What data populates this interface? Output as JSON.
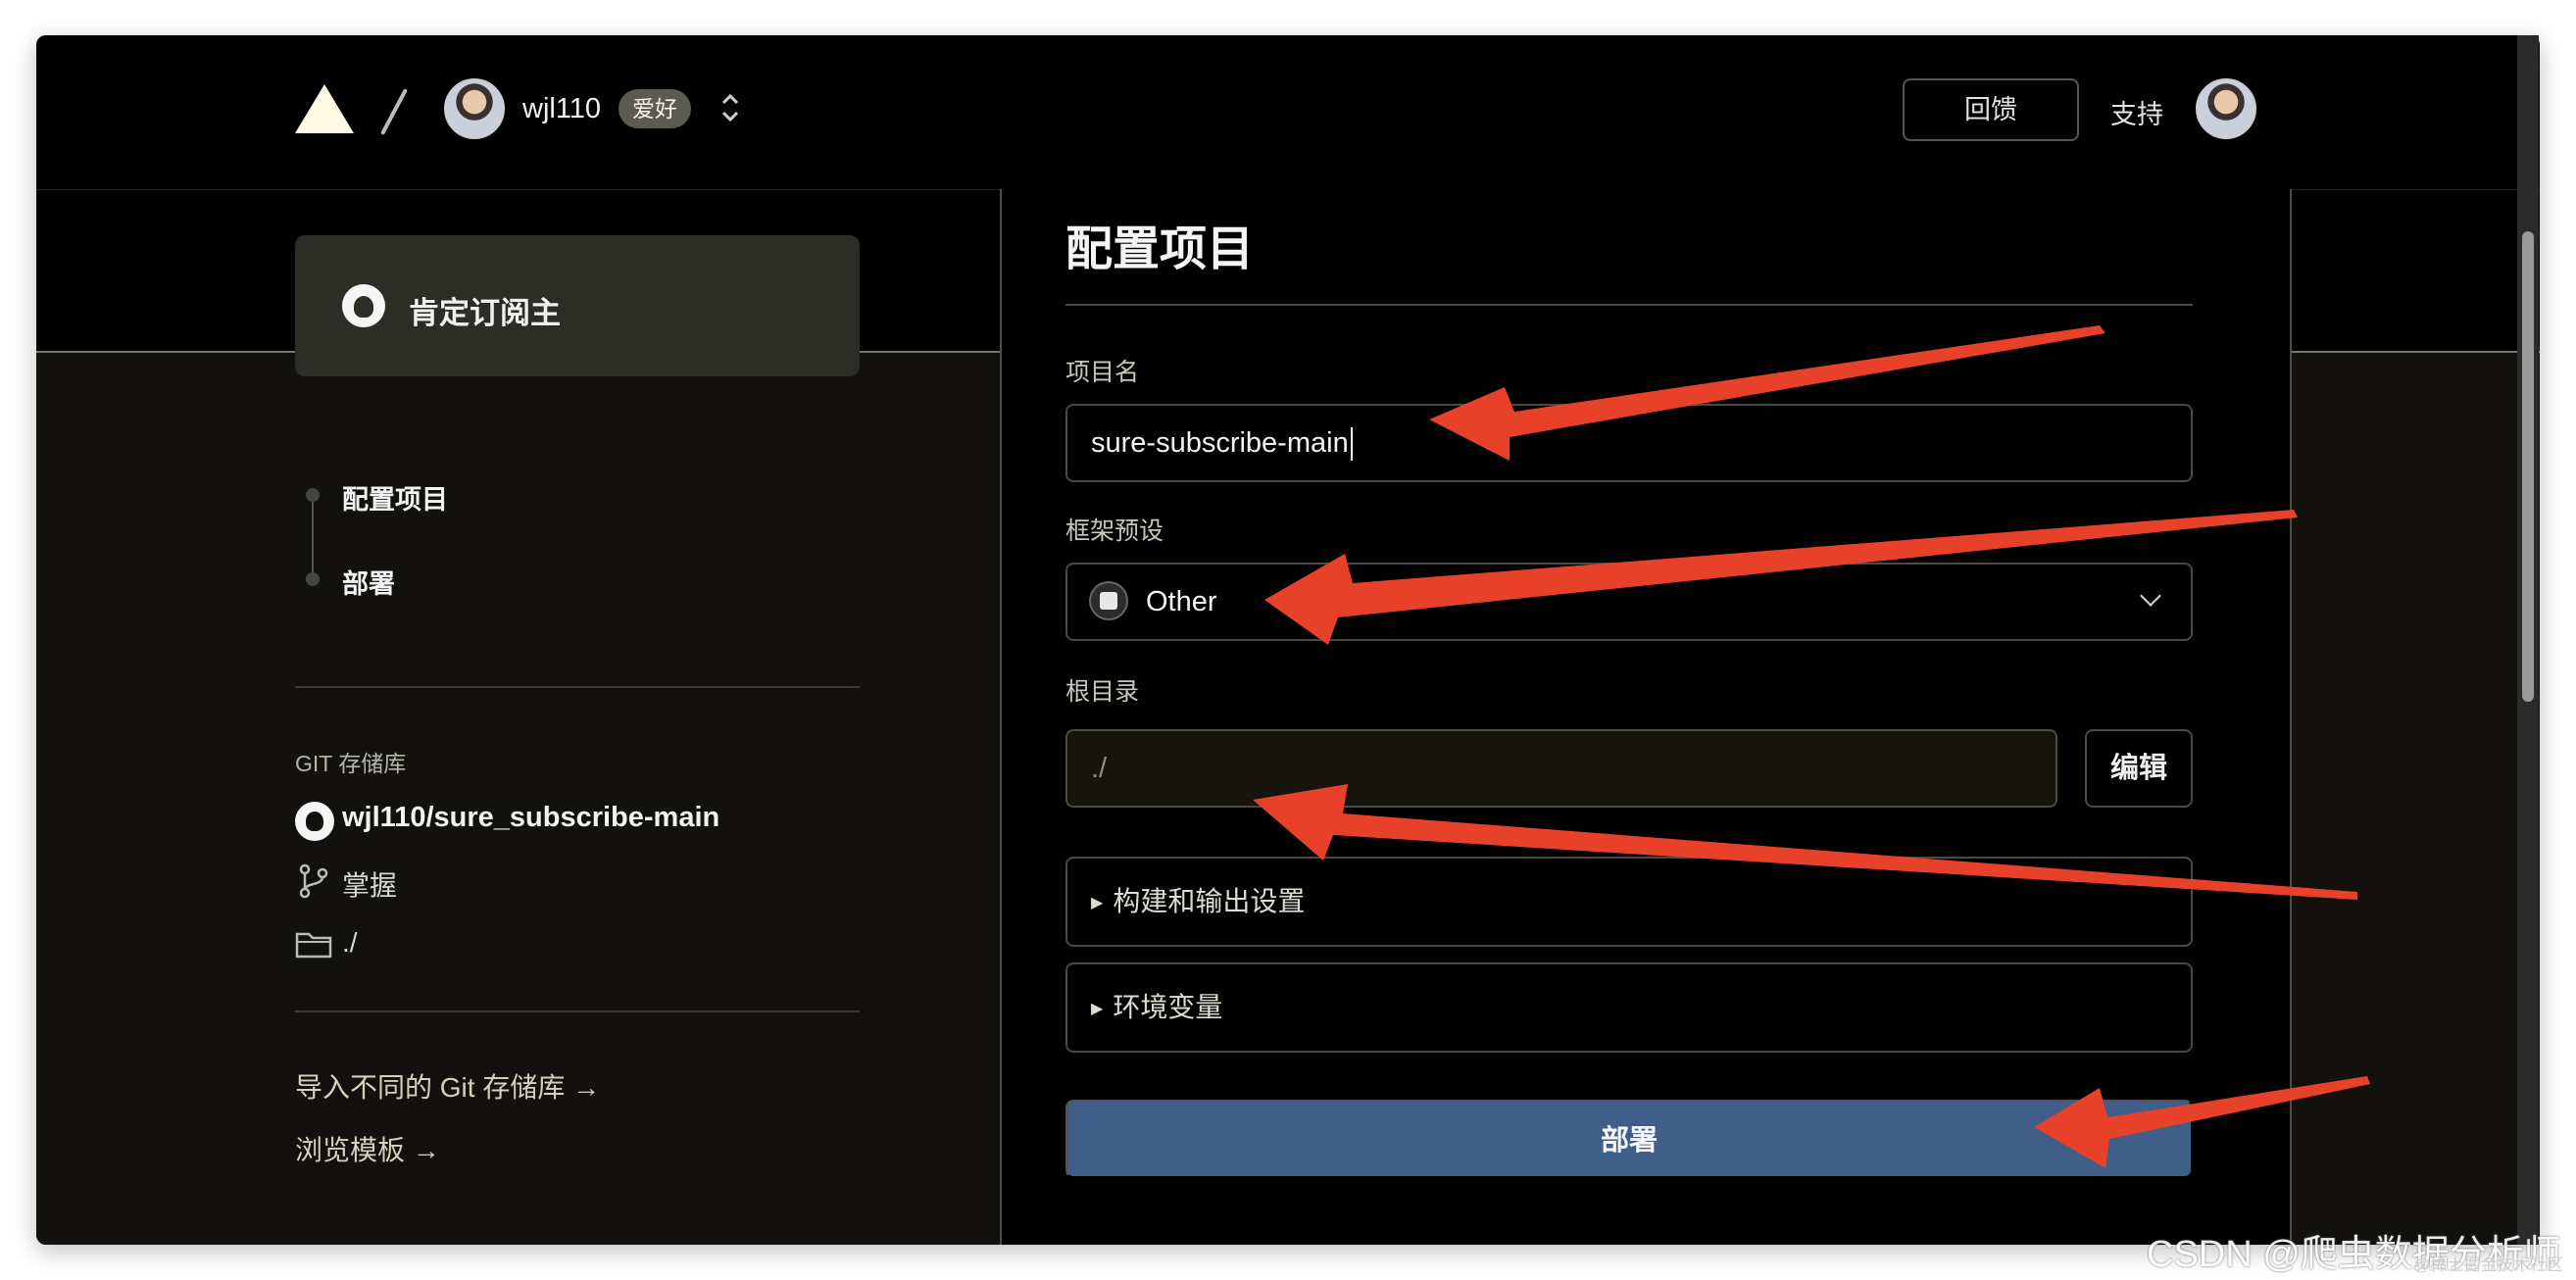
{
  "header": {
    "username": "wjl110",
    "badge": "爱好",
    "feedback_label": "回馈",
    "support_label": "支持"
  },
  "sidebar": {
    "repo_card_title": "肯定订阅主",
    "steps": [
      {
        "label": "配置项目"
      },
      {
        "label": "部署"
      }
    ],
    "git_heading": "GIT 存储库",
    "repo_name": "wjl110/sure_subscribe-main",
    "branch": "掌握",
    "root_dir": "./",
    "import_link": "导入不同的 Git 存储库 →",
    "template_link": "浏览模板 →"
  },
  "form": {
    "title": "配置项目",
    "project_name_label": "项目名",
    "project_name_value": "sure-subscribe-main",
    "preset_label": "框架预设",
    "preset_value": "Other",
    "root_label": "根目录",
    "root_value": "./",
    "edit_label": "编辑",
    "build_section": "构建和输出设置",
    "env_section": "环境变量",
    "deploy_label": "部署"
  },
  "watermark": {
    "main": "CSDN @爬虫数据分析师",
    "sub": "@稀土掘金技术社区"
  },
  "colors": {
    "accent_deploy": "#3f5f88",
    "annotation_arrow": "#e8412a"
  }
}
